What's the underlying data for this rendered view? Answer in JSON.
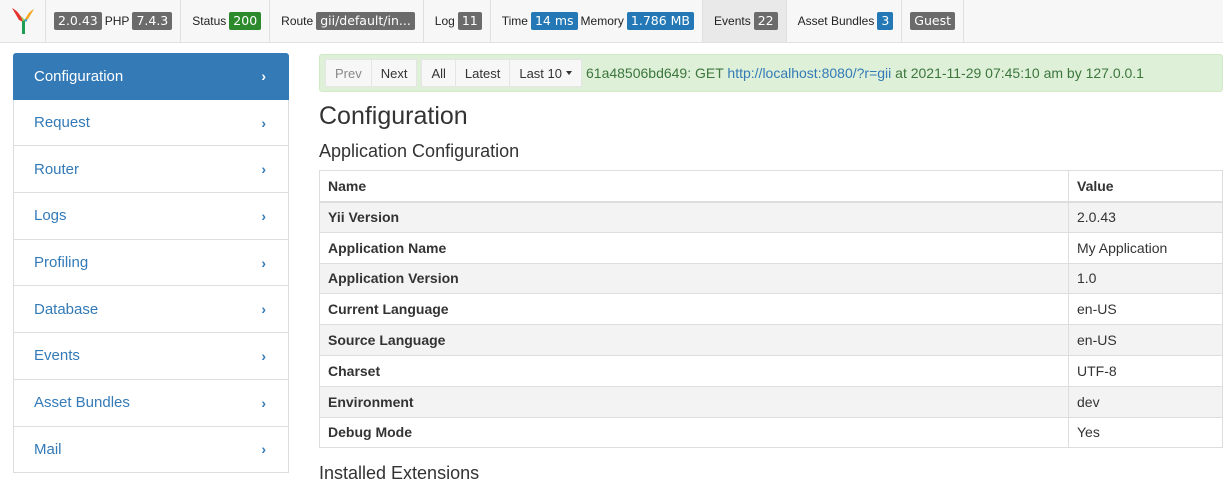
{
  "toolbar": {
    "yii_version": "2.0.43",
    "php_label": "PHP",
    "php_version": "7.4.3",
    "status_label": "Status",
    "status_code": "200",
    "route_label": "Route",
    "route_value": "gii/default/in...",
    "log_label": "Log",
    "log_count": "11",
    "time_label": "Time",
    "time_value": "14 ms",
    "memory_label": "Memory",
    "memory_value": "1.786 MB",
    "events_label": "Events",
    "events_count": "22",
    "assets_label": "Asset Bundles",
    "assets_count": "3",
    "user_value": "Guest",
    "logo_icon": "yii-logo-icon",
    "colors": {
      "green_badge": "#2c8a2c",
      "blue_badge": "#2378b5",
      "gray_badge": "#6b6b6b"
    }
  },
  "sidebar": {
    "items": [
      {
        "label": "Configuration",
        "active": true
      },
      {
        "label": "Request"
      },
      {
        "label": "Router"
      },
      {
        "label": "Logs"
      },
      {
        "label": "Profiling"
      },
      {
        "label": "Database"
      },
      {
        "label": "Events"
      },
      {
        "label": "Asset Bundles"
      },
      {
        "label": "Mail"
      }
    ],
    "chevron_icon": "chevron-right-icon"
  },
  "summary": {
    "prev": "Prev",
    "next": "Next",
    "all": "All",
    "latest": "Latest",
    "last10": "Last 10",
    "tag_method": "61a48506bd649: GET",
    "url": "http://localhost:8080/?r=gii",
    "suffix": "at 2021-11-29 07:45:10 am by 127.0.0.1"
  },
  "page": {
    "title": "Configuration",
    "section_title": "Application Configuration",
    "extensions_title": "Installed Extensions"
  },
  "config_table": {
    "headers": [
      "Name",
      "Value"
    ],
    "rows": [
      {
        "name": "Yii Version",
        "value": "2.0.43"
      },
      {
        "name": "Application Name",
        "value": "My Application"
      },
      {
        "name": "Application Version",
        "value": "1.0"
      },
      {
        "name": "Current Language",
        "value": "en-US"
      },
      {
        "name": "Source Language",
        "value": "en-US"
      },
      {
        "name": "Charset",
        "value": "UTF-8"
      },
      {
        "name": "Environment",
        "value": "dev"
      },
      {
        "name": "Debug Mode",
        "value": "Yes"
      }
    ]
  }
}
